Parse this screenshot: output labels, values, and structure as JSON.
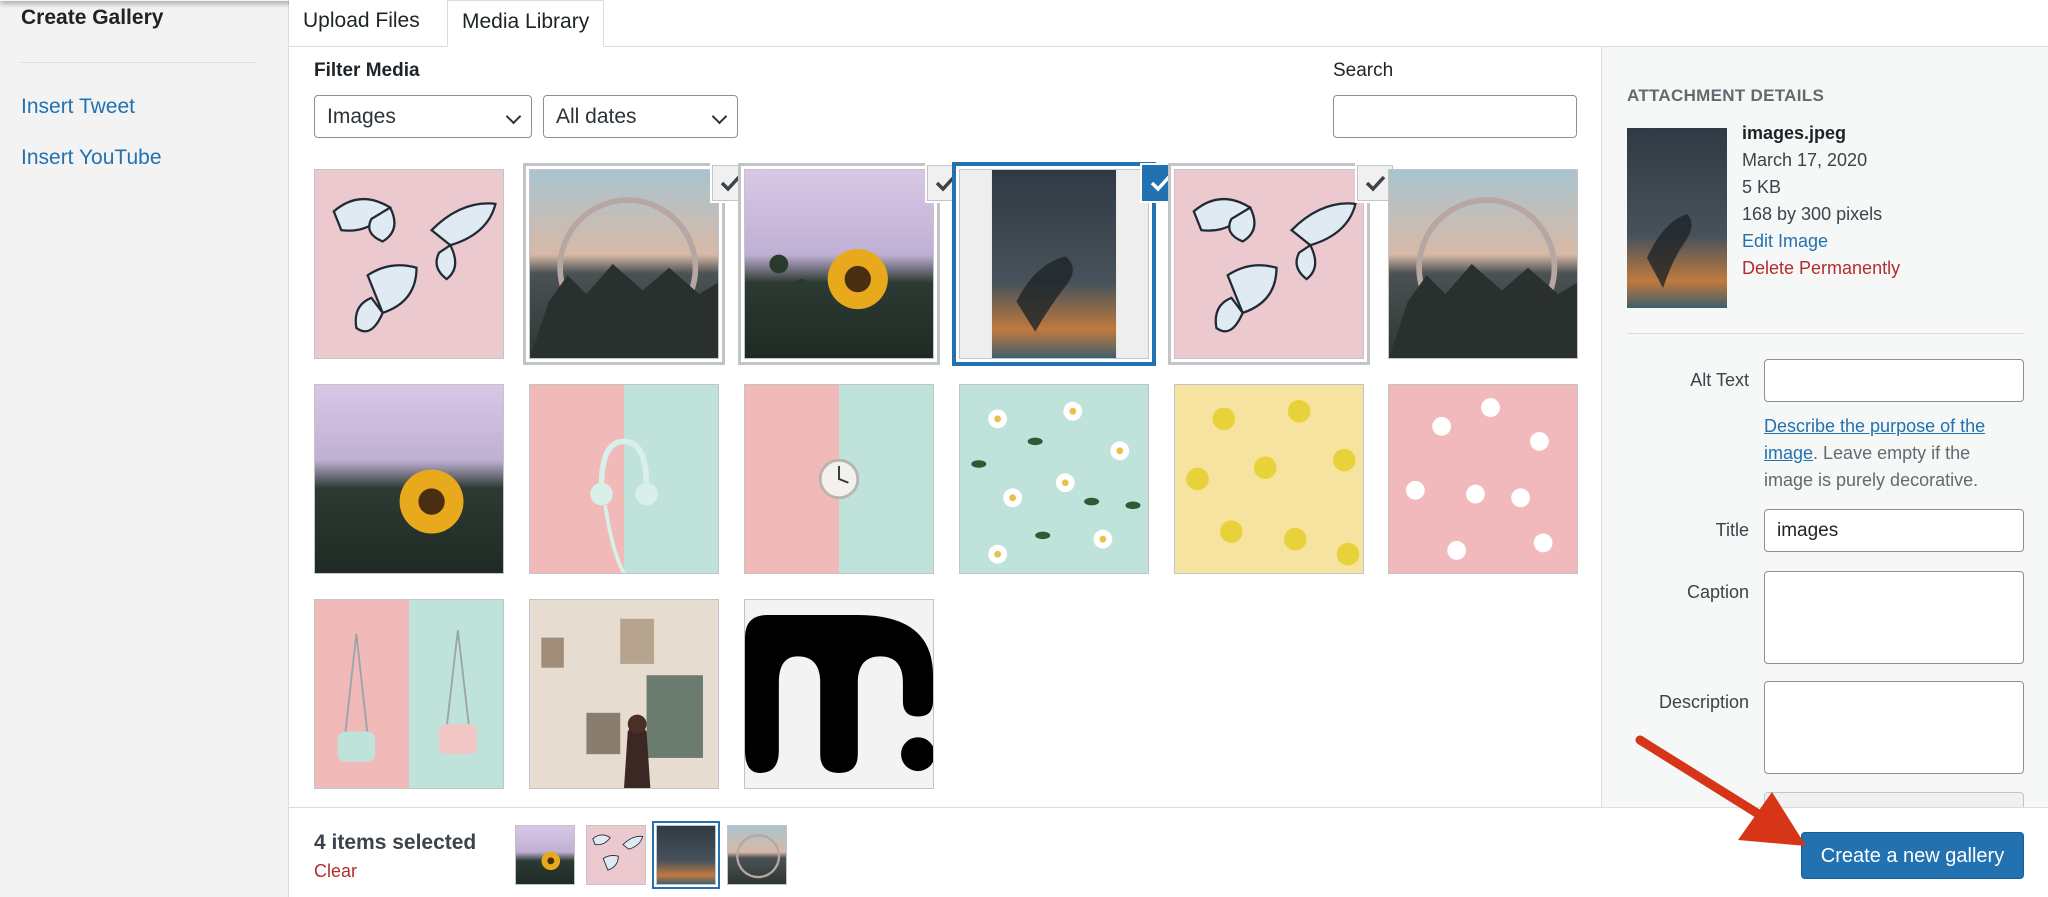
{
  "menu": {
    "title": "Create Gallery",
    "items": [
      {
        "label": "Insert Tweet"
      },
      {
        "label": "Insert YouTube"
      }
    ]
  },
  "tabs": [
    {
      "label": "Upload Files",
      "active": false
    },
    {
      "label": "Media Library",
      "active": true
    }
  ],
  "filters": {
    "label": "Filter Media",
    "type_value": "Images",
    "date_value": "All dates",
    "search_label": "Search",
    "search_value": ""
  },
  "media": [
    {
      "name": "butterflies",
      "selected": false
    },
    {
      "name": "mirror-field",
      "selected": true
    },
    {
      "name": "sunflower-purple",
      "selected": true
    },
    {
      "name": "hand-galaxy",
      "selected": true,
      "current": true
    },
    {
      "name": "butterflies",
      "selected": true
    },
    {
      "name": "mirror-field",
      "selected": false
    },
    {
      "name": "sunflower-purple",
      "selected": false
    },
    {
      "name": "headphones-pink-mint",
      "selected": false
    },
    {
      "name": "clock-pink-mint",
      "selected": false
    },
    {
      "name": "daisies-mint",
      "selected": false
    },
    {
      "name": "flowers-yellow",
      "selected": false
    },
    {
      "name": "daisies-pink",
      "selected": false
    },
    {
      "name": "bags-pink-mint",
      "selected": false
    },
    {
      "name": "woman-gallery-wall",
      "selected": false
    },
    {
      "name": "black-logo",
      "selected": false
    }
  ],
  "attachment": {
    "heading": "ATTACHMENT DETAILS",
    "filename": "images.jpeg",
    "date": "March 17, 2020",
    "size": "5 KB",
    "dimensions": "168 by 300 pixels",
    "edit_label": "Edit Image",
    "delete_label": "Delete Permanently",
    "alt_label": "Alt Text",
    "alt_value": "",
    "alt_help_link": "Describe the purpose of the image",
    "alt_help_rest": ". Leave empty if the image is purely decorative.",
    "title_label": "Title",
    "title_value": "images",
    "caption_label": "Caption",
    "description_label": "Description"
  },
  "toolbar": {
    "count_label": "4 items selected",
    "clear_label": "Clear",
    "selected_thumbs": [
      "sunflower-purple",
      "butterflies",
      "hand-galaxy",
      "mirror-field"
    ],
    "create_label": "Create a new gallery"
  },
  "colors": {
    "accent": "#2271b1",
    "danger": "#b32d2e",
    "annotation_arrow": "#d63518"
  }
}
